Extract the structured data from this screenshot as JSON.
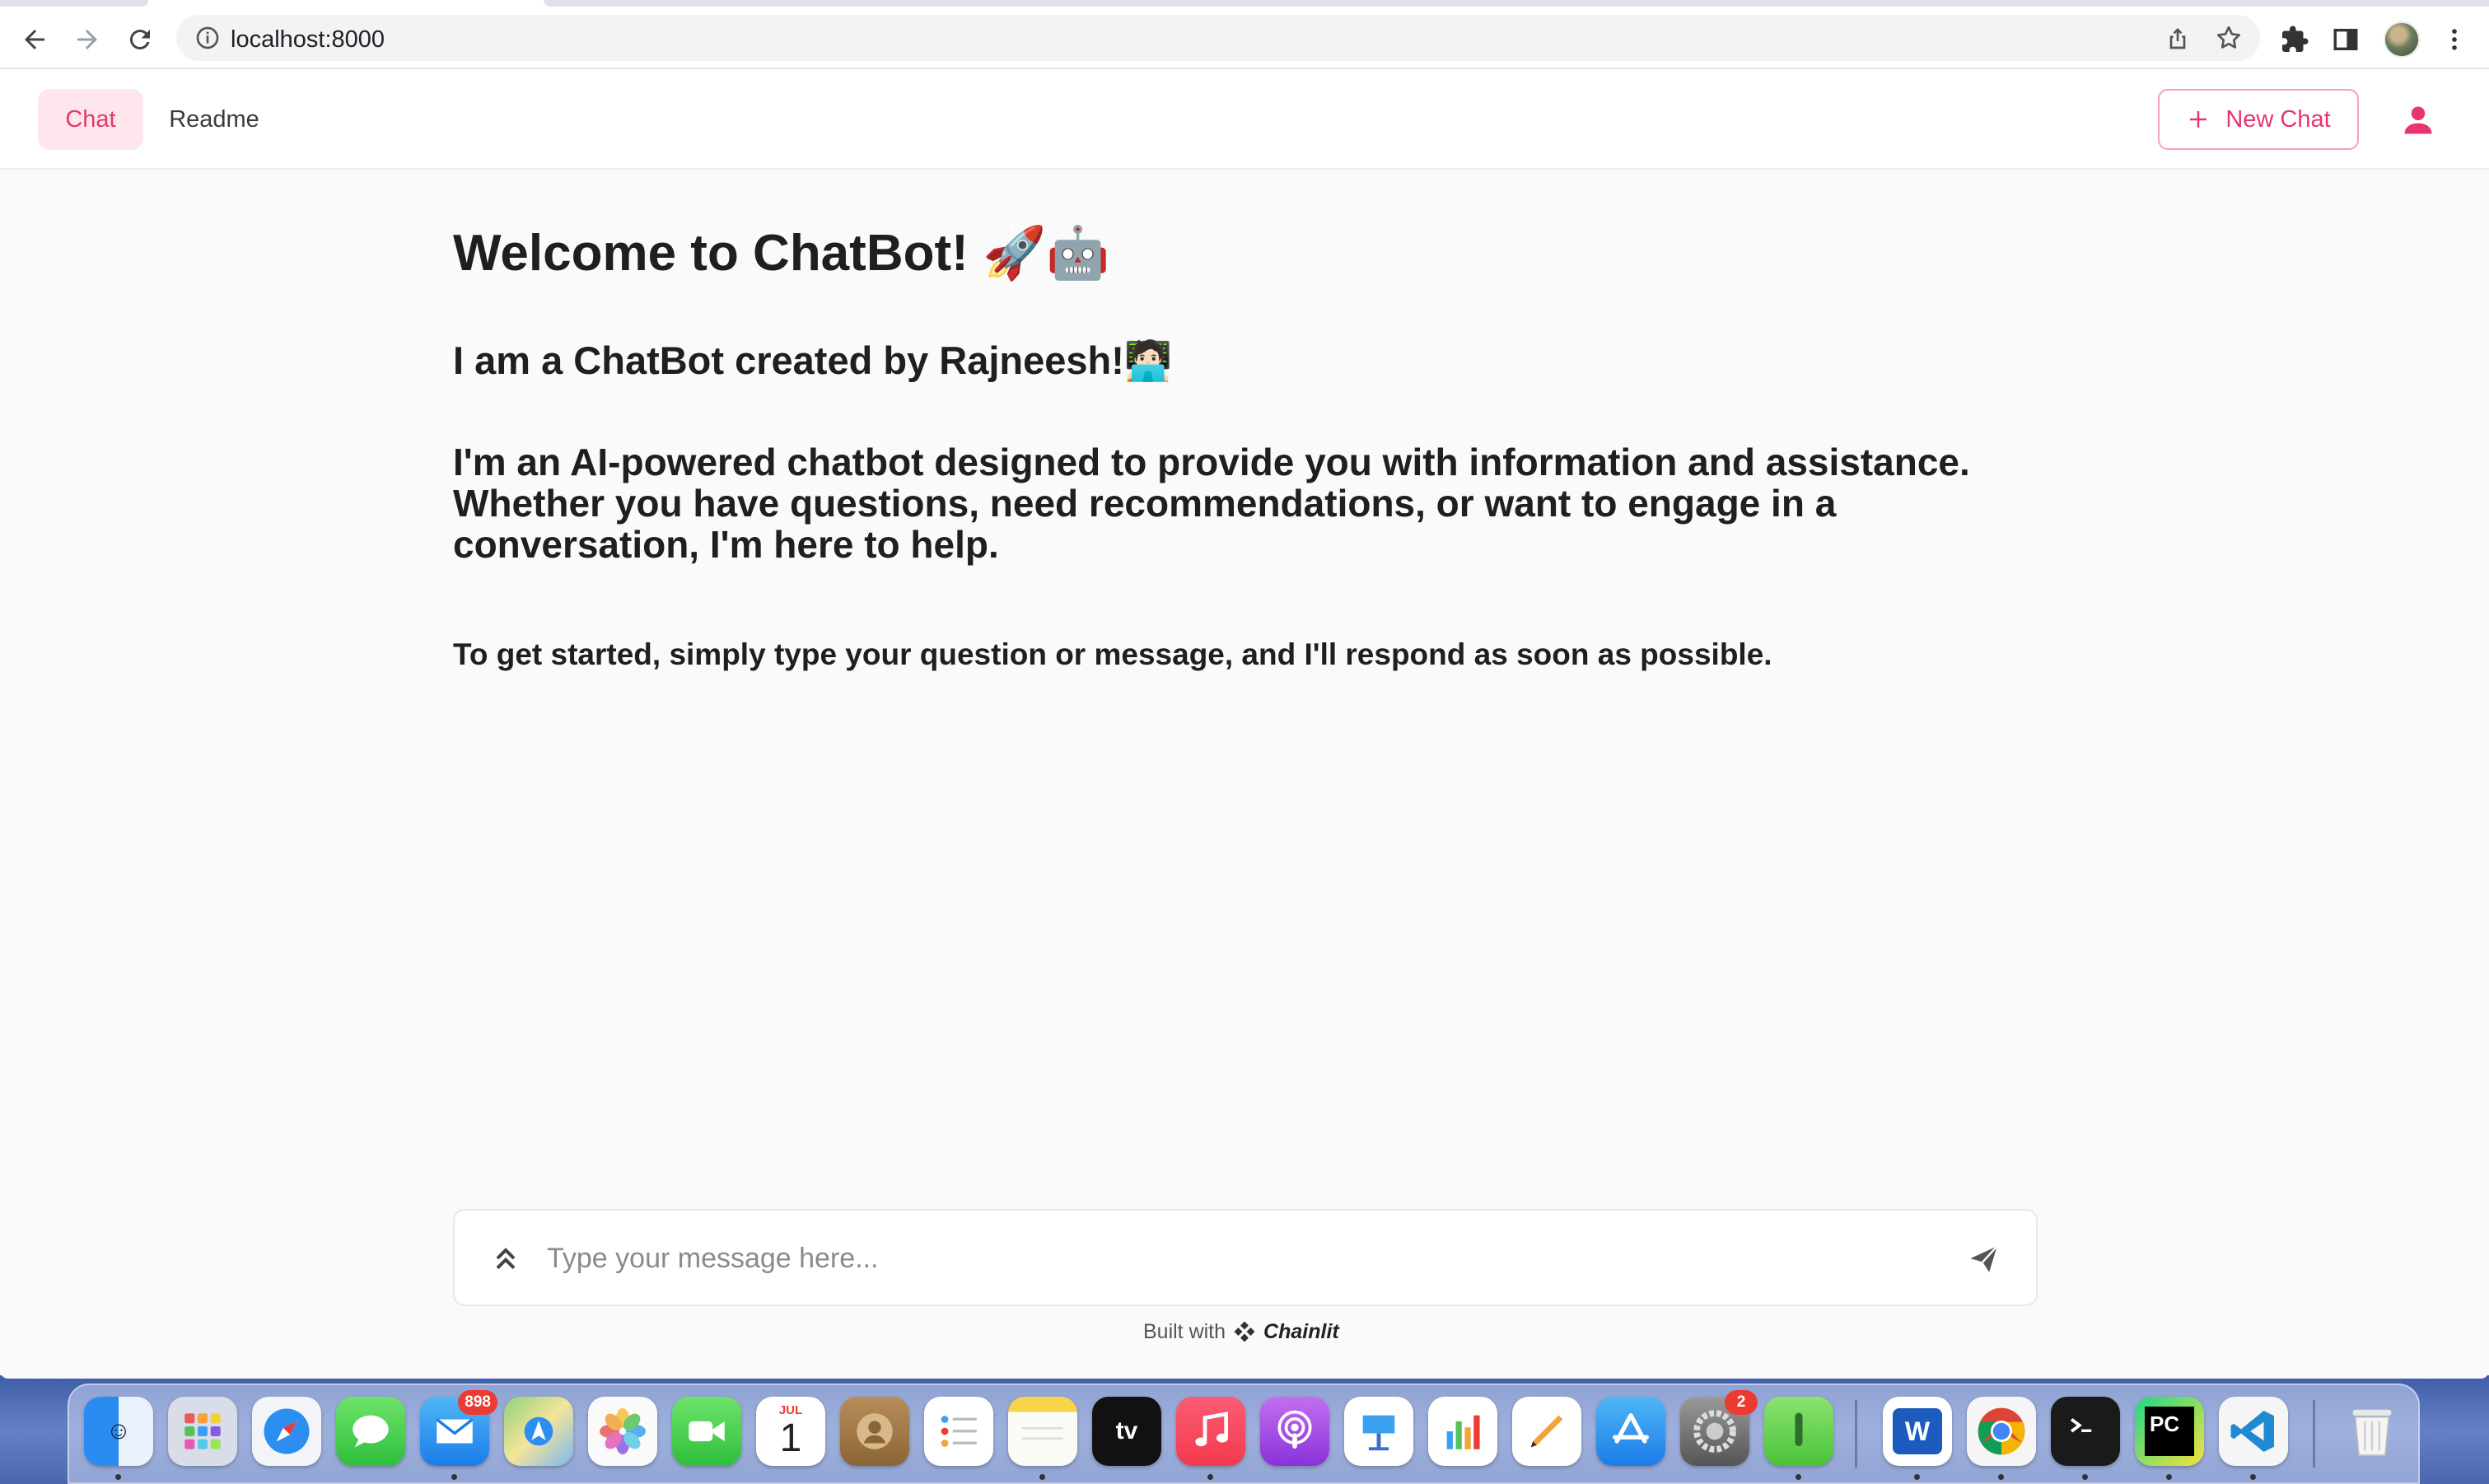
{
  "browser": {
    "url": "localhost:8000"
  },
  "app": {
    "tabs": [
      {
        "label": "Chat",
        "active": true
      },
      {
        "label": "Readme",
        "active": false
      }
    ],
    "new_chat_label": "New Chat"
  },
  "welcome": {
    "title": "Welcome to ChatBot! 🚀🤖",
    "subtitle": "I am a ChatBot created by Rajneesh!🧑🏻‍💻",
    "description": "I'm an AI-powered chatbot designed to provide you with information and assistance. Whether you have questions, need recommendations, or want to engage in a conversation, I'm here to help.",
    "instruction": "To get started, simply type your question or message, and I'll respond as soon as possible."
  },
  "composer": {
    "placeholder": "Type your message here..."
  },
  "footer": {
    "built_with": "Built with",
    "brand": "Chainlit"
  },
  "dock": {
    "mail_badge": "898",
    "calendar_month": "JUL",
    "calendar_day": "1",
    "settings_badge": "2",
    "tv_label": "tv",
    "pycharm_label": "PC",
    "word_label": "W"
  },
  "colors": {
    "accent": "#e6366c",
    "accent_bg": "#fde7ec",
    "page_bg": "#fafafa"
  }
}
